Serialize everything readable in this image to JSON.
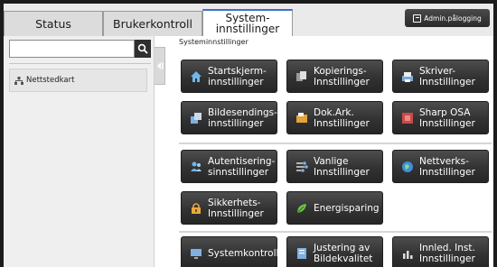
{
  "tabs": [
    {
      "label": "Status"
    },
    {
      "label": "Brukerkontroll"
    },
    {
      "label_line1": "System-",
      "label_line2": "innstillinger"
    }
  ],
  "header": {
    "admin_button": "Admin.pålogging"
  },
  "search": {
    "value": "",
    "placeholder": ""
  },
  "sidebar": {
    "sitemap_label": "Nettstedkart"
  },
  "breadcrumb": "Systeminnstillinger",
  "groups": [
    {
      "buttons": [
        {
          "label": "Startskjerm-\ninnstillinger",
          "icon": "home-icon"
        },
        {
          "label": "Kopierings-\nInnstillinger",
          "icon": "copy-icon"
        },
        {
          "label": "Skriver-\nInnstillinger",
          "icon": "printer-icon"
        },
        {
          "label": "Bildesendings-\ninnstillinger",
          "icon": "image-send-icon"
        },
        {
          "label": "Dok.Ark.\nInnstillinger",
          "icon": "folder-icon"
        },
        {
          "label": "Sharp OSA\nInnstillinger",
          "icon": "osa-icon"
        }
      ]
    },
    {
      "buttons": [
        {
          "label": "Autentisering-\nsinnstillinger",
          "icon": "users-icon"
        },
        {
          "label": "Vanlige\nInnstillinger",
          "icon": "settings-icon"
        },
        {
          "label": "Nettverks-\nInnstillinger",
          "icon": "network-icon"
        },
        {
          "label": "Sikkerhets-\nInnstillinger",
          "icon": "lock-icon"
        },
        {
          "label": "Energisparing",
          "icon": "leaf-icon"
        }
      ]
    },
    {
      "buttons": [
        {
          "label": "Systemkontroll",
          "icon": "monitor-icon"
        },
        {
          "label": "Justering av\nBildekvalitet",
          "icon": "document-icon"
        },
        {
          "label": "Innled. Inst.\nInnstillinger",
          "icon": "chart-icon"
        }
      ]
    }
  ],
  "colors": {
    "accent": "#3c6fd0",
    "button_bg": "#333333",
    "page_bg": "#ffffff"
  }
}
